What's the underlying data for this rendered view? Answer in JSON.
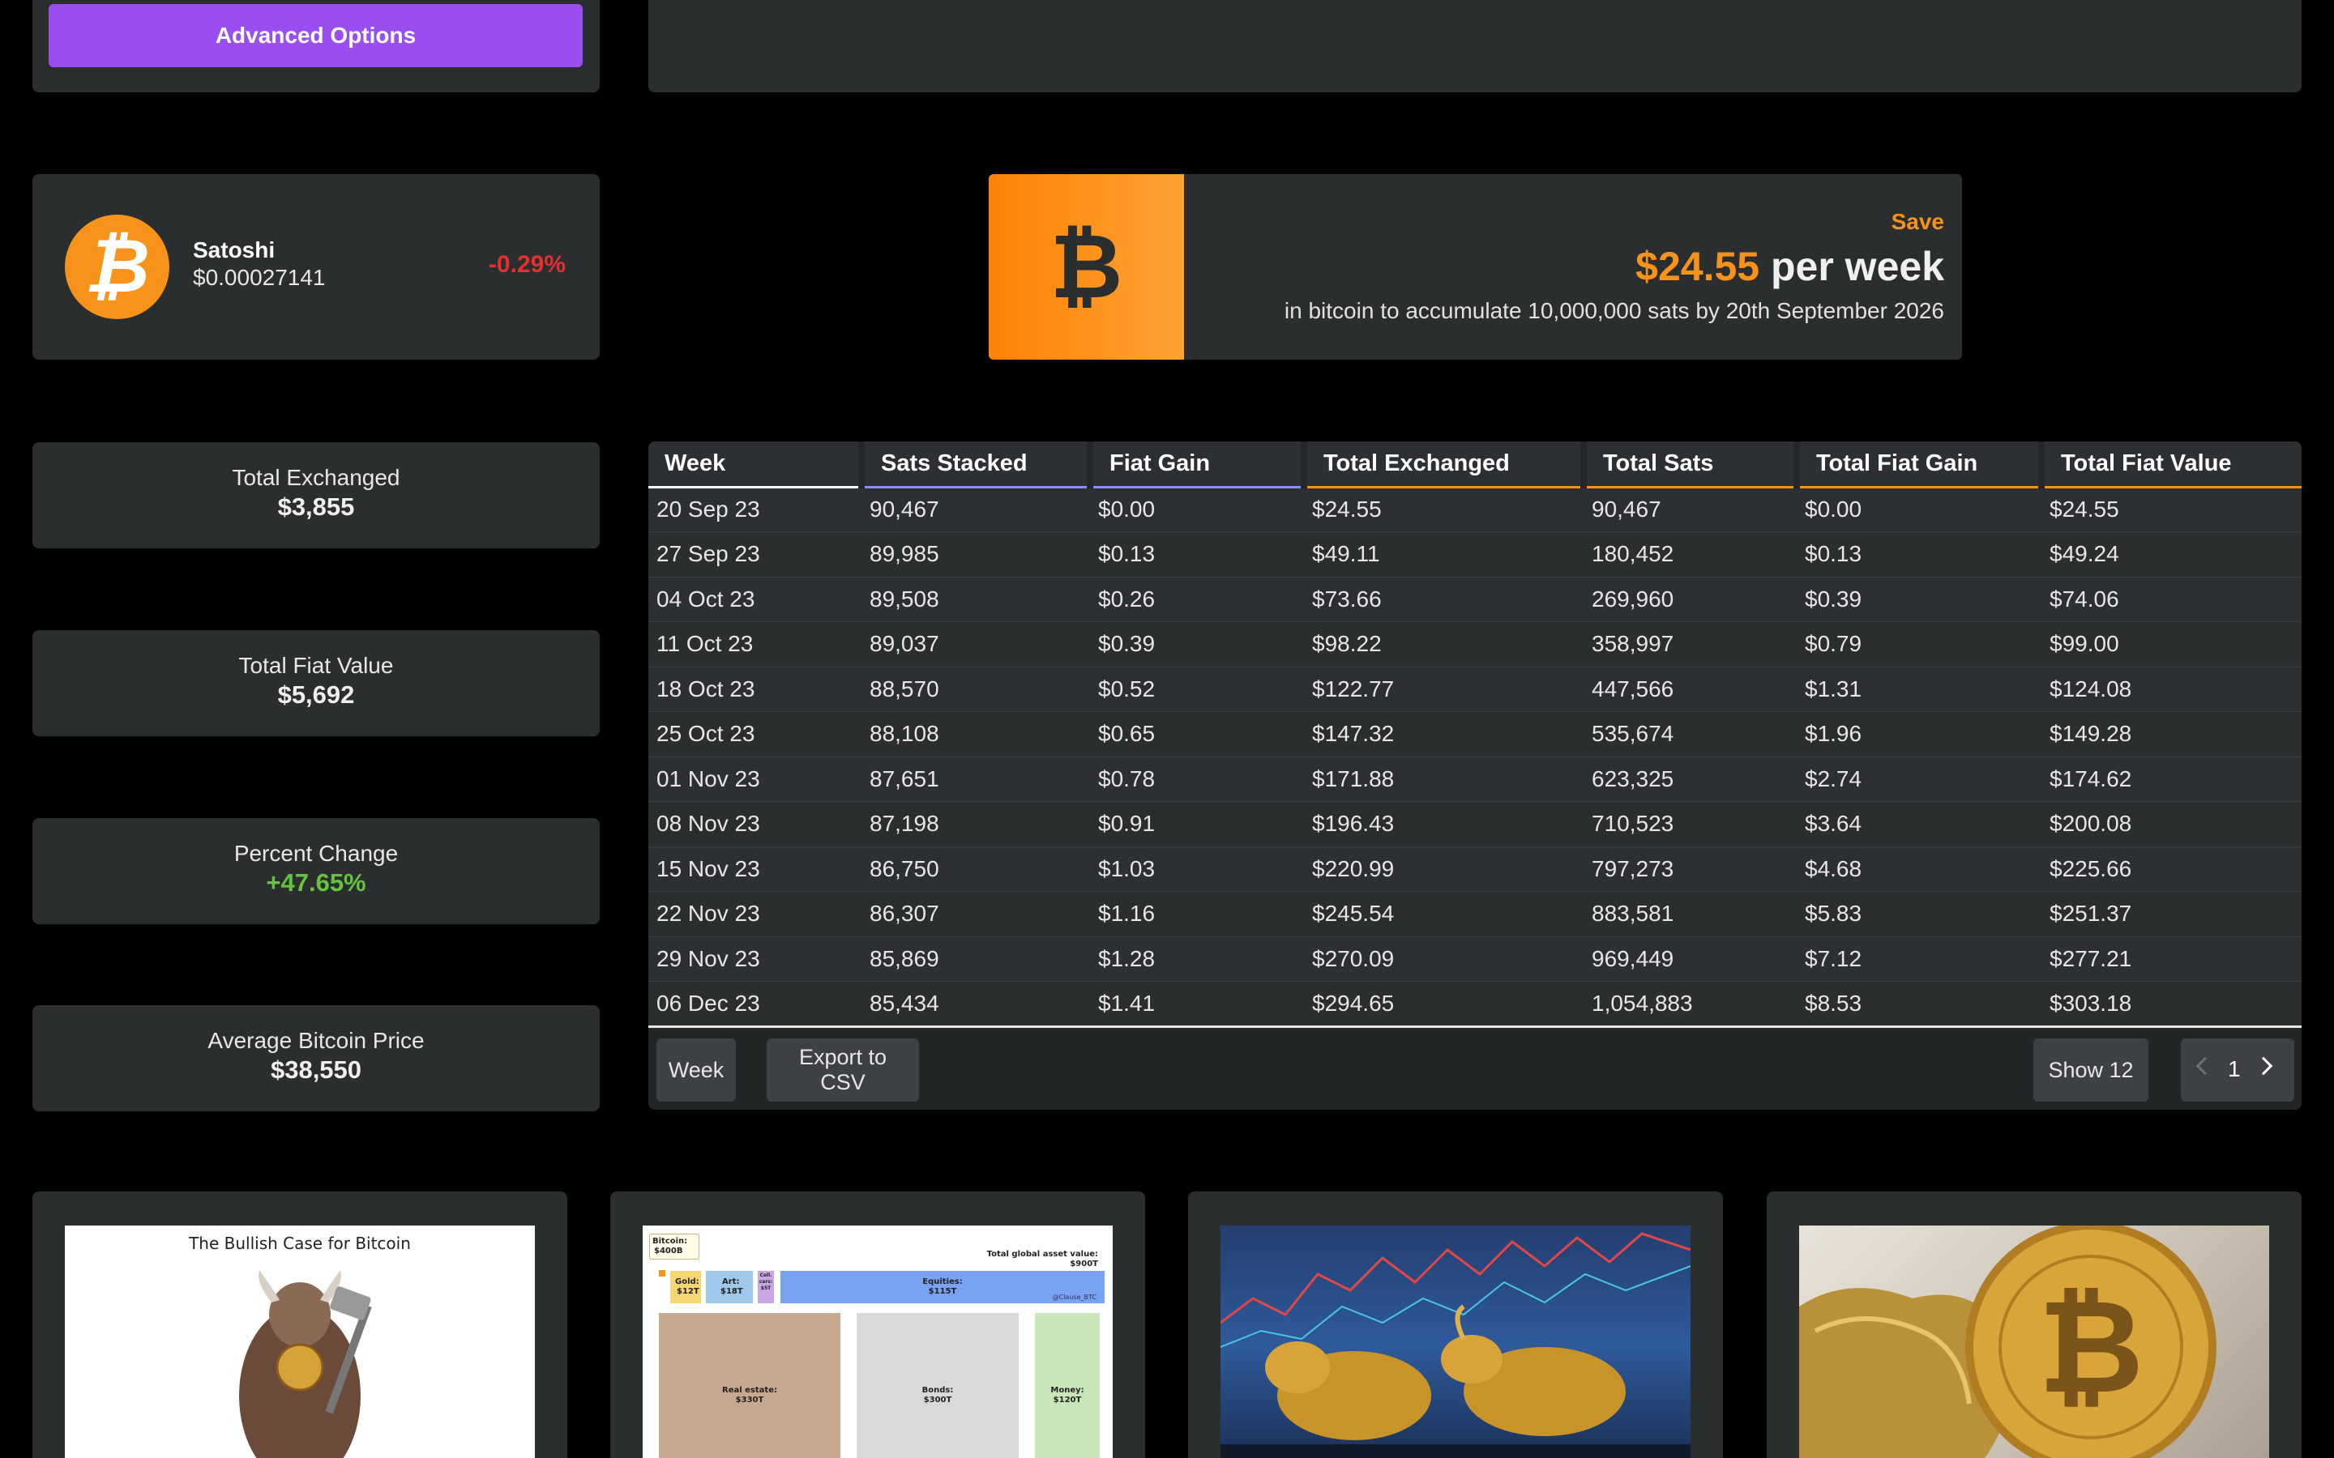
{
  "advanced": {
    "button_label": "Advanced Options"
  },
  "coin": {
    "logo_symbol": "₿",
    "name": "Satoshi",
    "price": "$0.00027141",
    "change": "-0.29%",
    "change_color": "#e3302f"
  },
  "save": {
    "icon_symbol": "₿",
    "label": "Save",
    "amount": "$24.55",
    "per": "per week",
    "description": "in bitcoin to accumulate 10,000,000 sats by 20th September 2026",
    "accent": "#f7931a"
  },
  "stats": {
    "total_exchanged": {
      "label": "Total Exchanged",
      "value": "$3,855"
    },
    "total_fiat_value": {
      "label": "Total Fiat Value",
      "value": "$5,692"
    },
    "percent_change": {
      "label": "Percent Change",
      "value": "+47.65%",
      "color": "#64c43c"
    },
    "avg_price": {
      "label": "Average Bitcoin Price",
      "value": "$38,550"
    }
  },
  "table": {
    "headers": [
      "Week",
      "Sats Stacked",
      "Fiat Gain",
      "Total Exchanged",
      "Total Sats",
      "Total Fiat Gain",
      "Total Fiat Value"
    ],
    "rows": [
      [
        "20 Sep 23",
        "90,467",
        "$0.00",
        "$24.55",
        "90,467",
        "$0.00",
        "$24.55"
      ],
      [
        "27 Sep 23",
        "89,985",
        "$0.13",
        "$49.11",
        "180,452",
        "$0.13",
        "$49.24"
      ],
      [
        "04 Oct 23",
        "89,508",
        "$0.26",
        "$73.66",
        "269,960",
        "$0.39",
        "$74.06"
      ],
      [
        "11 Oct 23",
        "89,037",
        "$0.39",
        "$98.22",
        "358,997",
        "$0.79",
        "$99.00"
      ],
      [
        "18 Oct 23",
        "88,570",
        "$0.52",
        "$122.77",
        "447,566",
        "$1.31",
        "$124.08"
      ],
      [
        "25 Oct 23",
        "88,108",
        "$0.65",
        "$147.32",
        "535,674",
        "$1.96",
        "$149.28"
      ],
      [
        "01 Nov 23",
        "87,651",
        "$0.78",
        "$171.88",
        "623,325",
        "$2.74",
        "$174.62"
      ],
      [
        "08 Nov 23",
        "87,198",
        "$0.91",
        "$196.43",
        "710,523",
        "$3.64",
        "$200.08"
      ],
      [
        "15 Nov 23",
        "86,750",
        "$1.03",
        "$220.99",
        "797,273",
        "$4.68",
        "$225.66"
      ],
      [
        "22 Nov 23",
        "86,307",
        "$1.16",
        "$245.54",
        "883,581",
        "$5.83",
        "$251.37"
      ],
      [
        "29 Nov 23",
        "85,869",
        "$1.28",
        "$270.09",
        "969,449",
        "$7.12",
        "$277.21"
      ],
      [
        "06 Dec 23",
        "85,434",
        "$1.41",
        "$294.65",
        "1,054,883",
        "$8.53",
        "$303.18"
      ]
    ],
    "buttons": {
      "week": "Week",
      "export": "Export to CSV",
      "show": "Show 12"
    },
    "pager": {
      "page": "1"
    }
  },
  "cards": {
    "card1": {
      "title": "The Bullish Case for Bitcoin"
    },
    "card2": {
      "bitcoin": "Bitcoin:",
      "bitcoin_val": "$400B",
      "total": "Total global asset value:",
      "total_val": "$900T",
      "gold": "Gold:",
      "gold_val": "$12T",
      "art": "Art:",
      "art_val": "$18T",
      "coll_a": "Coll.",
      "coll_b": "cars:",
      "coll_c": "$5T",
      "equities": "Equities:",
      "equities_val": "$115T",
      "handle": "@Clause_BTC",
      "realestate": "Real estate:",
      "realestate_val": "$330T",
      "bonds": "Bonds:",
      "bonds_val": "$300T",
      "money": "Money:",
      "money_val": "$120T"
    }
  }
}
